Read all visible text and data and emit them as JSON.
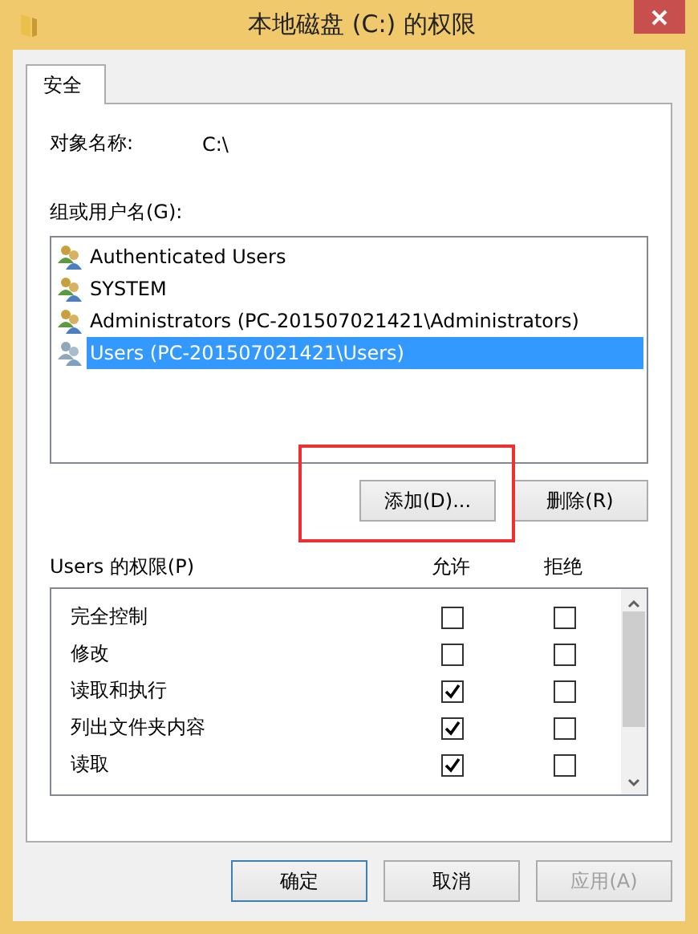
{
  "window": {
    "title": "本地磁盘 (C:) 的权限"
  },
  "tabs": [
    {
      "label": "安全",
      "selected": true
    }
  ],
  "object_name": {
    "label": "对象名称:",
    "value": "C:\\"
  },
  "groups": {
    "label": "组或用户名(G):",
    "items": [
      {
        "name": "Authenticated Users",
        "selected": false
      },
      {
        "name": "SYSTEM",
        "selected": false
      },
      {
        "name": "Administrators (PC-201507021421\\Administrators)",
        "selected": false
      },
      {
        "name": "Users (PC-201507021421\\Users)",
        "selected": true
      }
    ],
    "buttons": [
      {
        "label": "添加(D)...",
        "highlighted": true
      },
      {
        "label": "删除(R)",
        "highlighted": false
      }
    ]
  },
  "permissions": {
    "label": "Users 的权限(P)",
    "allow_header": "允许",
    "deny_header": "拒绝",
    "rows": [
      {
        "name": "完全控制",
        "allow": false,
        "deny": false
      },
      {
        "name": "修改",
        "allow": false,
        "deny": false
      },
      {
        "name": "读取和执行",
        "allow": true,
        "deny": false
      },
      {
        "name": "列出文件夹内容",
        "allow": true,
        "deny": false
      },
      {
        "name": "读取",
        "allow": true,
        "deny": false
      }
    ]
  },
  "footer_buttons": [
    {
      "label": "确定",
      "default": true,
      "disabled": false
    },
    {
      "label": "取消",
      "default": false,
      "disabled": false
    },
    {
      "label": "应用(A)",
      "default": false,
      "disabled": true
    }
  ]
}
